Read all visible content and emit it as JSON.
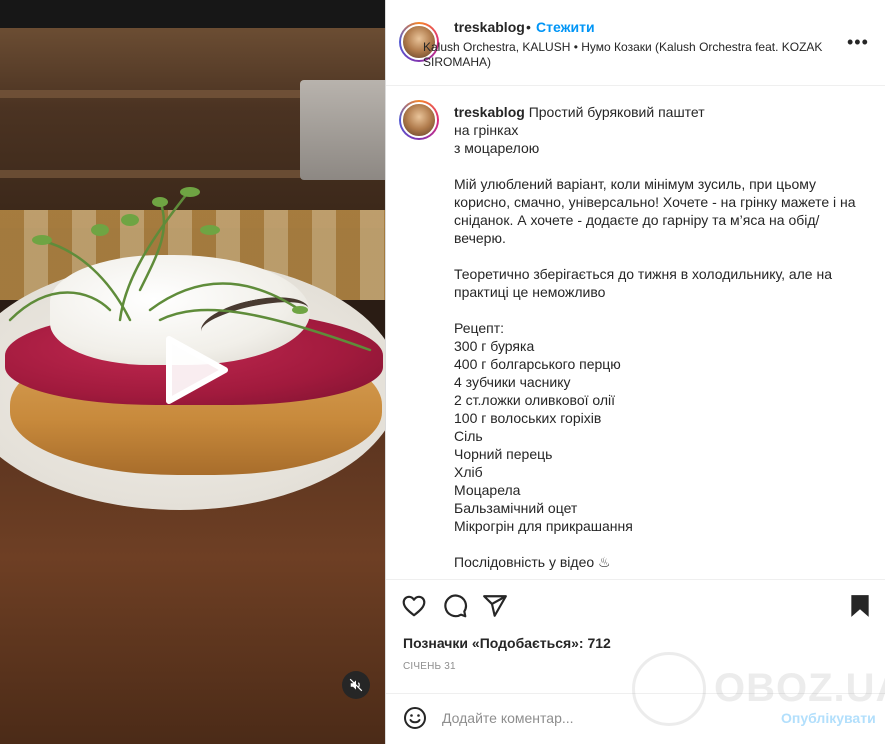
{
  "post": {
    "username": "treskablog",
    "follow_label": "Стежити",
    "separator": "•",
    "audio_line": "Kalush Orchestra, KALUSH • Нумо Козаки (Kalush Orchestra feat. KOZAK SIROMAHA)",
    "more_label": "•••"
  },
  "caption": {
    "username": "treskablog",
    "text": "Простий буряковий паштет \nна грінках\nз моцарелою\n\nМій улюблений варіант, коли мінімум зусиль, при цьому корисно, смачно, універсально! Хочете - на грінку мажете і на сніданок. А хочете - додаєте до гарніру та м’яса на обід/вечерю.\n\nТеоретично зберігається до тижня в холодильнику, але на практиці це неможливо \n\nРецепт:\n300 г буряка\n400 г болгарського перцю\n4 зубчики часнику\n2 ст.ложки оливкової олії\n100 г волоських горіхів\nСіль\nЧорний перець\nХліб\nМоцарела\nБальзамічний оцет\nМікрогрін для прикрашання\n\nПослідовність у відео ♨"
  },
  "engagement": {
    "likes_text": "Позначки «Подобається»: 712",
    "date": "СІЧЕНЬ 31"
  },
  "comment": {
    "placeholder": "Додайте коментар...",
    "publish_label": "Опублікувати"
  },
  "watermark": {
    "text": "OBOZ.UA"
  },
  "icons": [
    "play-icon",
    "mute-icon",
    "heart-icon",
    "comment-icon",
    "share-icon",
    "bookmark-icon",
    "emoji-icon",
    "more-icon"
  ],
  "colors": {
    "accent_blue": "#0095f6",
    "publish_disabled": "#b2dffc",
    "text": "#262626",
    "muted": "#8e8e8e"
  }
}
